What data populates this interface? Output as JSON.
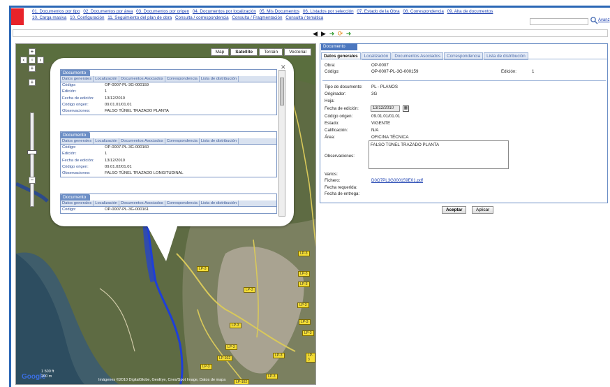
{
  "nav": {
    "links": [
      "01. Documentos por tipo",
      "02. Documentos por área",
      "03. Documentos por origen",
      "04. Documentos por localización",
      "05. Mis Documentos",
      "06. Listados por selección",
      "07. Estado de la Obra",
      "08. Correspondencia",
      "09. Alta de documentos",
      "10. Carga masiva",
      "10. Configuración",
      "11. Seguimiento del plan de obra",
      "Consulta / correspondencia",
      "Consulta / Fragmentación",
      "Consulta / temática"
    ]
  },
  "search": {
    "value": "",
    "link_label": "Avanz"
  },
  "map": {
    "types": [
      "Map",
      "Satellite",
      "Terrain",
      "Vectorial"
    ],
    "active_type": "Satellite",
    "road_labels": [
      "LP-3",
      "LP-3",
      "LP-3",
      "LP-3",
      "LP-3",
      "LP-3",
      "LP-3",
      "LP-3",
      "LP-3",
      "LP-3",
      "LP-3",
      "LP-3",
      "LP-3",
      "LP-3",
      "LP-102",
      "LP-102"
    ],
    "scale_ft": "1 500 ft",
    "scale_m": "200 m",
    "copyright": "Imágenes ©2010 DigitalGlobe, GeoEye, Cnes/Spot Image, Datos de mapa",
    "google": "Google"
  },
  "balloon": {
    "cards": [
      {
        "title": "Documento",
        "tabs": [
          "Datos generales",
          "Localización",
          "Documentos Asociados",
          "Correspondencia",
          "Lista de distribución"
        ],
        "rows": [
          {
            "label": "Código:",
            "value": "OP-0007-PL-3G-000159"
          },
          {
            "label": "Edición:",
            "value": "1"
          },
          {
            "label": "Fecha de edición:",
            "value": "13/12/2010"
          },
          {
            "label": "Código origen:",
            "value": "09.01.01/01.01"
          },
          {
            "label": "Observaciones:",
            "value": "FALSO TÚNEL TRAZADO PLANTA"
          }
        ]
      },
      {
        "title": "Documento",
        "tabs": [
          "Datos generales",
          "Localización",
          "Documentos Asociados",
          "Correspondencia",
          "Lista de distribución"
        ],
        "rows": [
          {
            "label": "Código:",
            "value": "OP-0007-PL-3G-000160"
          },
          {
            "label": "Edición:",
            "value": "1"
          },
          {
            "label": "Fecha de edición:",
            "value": "13/12/2010"
          },
          {
            "label": "Código origen:",
            "value": "09.01.02/01.01"
          },
          {
            "label": "Observaciones:",
            "value": "FALSO TÚNEL TRAZADO LONGITUDINAL"
          }
        ]
      },
      {
        "title": "Documento",
        "tabs": [
          "Datos generales",
          "Localización",
          "Documentos Asociados",
          "Correspondencia",
          "Lista de distribución"
        ],
        "rows": [
          {
            "label": "Código:",
            "value": "OP-0007-PL-3G-000161"
          }
        ]
      }
    ]
  },
  "panel": {
    "title": "Documento",
    "tabs": [
      "Datos generales",
      "Localización",
      "Documentos Asociados",
      "Correspondencia",
      "Lista de distribución"
    ],
    "obra_label": "Obra:",
    "obra": "OP-0007",
    "codigo_label": "Código:",
    "codigo": "OP-0007-PL-3G-000159",
    "edicion_label": "Edición:",
    "edicion": "1",
    "tipo_label": "Tipo de documento:",
    "tipo": "PL - PLANOS",
    "originador_label": "Originador:",
    "originador": "3G",
    "hoja_label": "Hoja:",
    "hoja": "",
    "fecha_label": "Fecha de edición:",
    "fecha": "13/12/2010",
    "codorigen_label": "Código origen:",
    "codorigen": "09.01.01/01.01",
    "estado_label": "Estado:",
    "estado": "VIGENTE",
    "calificacion_label": "Calificación:",
    "calificacion": "N/A",
    "area_label": "Área:",
    "area": "OFICINA TÉCNICA",
    "observaciones_label": "Observaciones:",
    "observaciones": "FALSO TÚNEL TRAZADO PLANTA",
    "varios_label": "Varios:",
    "fichero_label": "Fichero:",
    "fichero": "D0O7PL3G000159E01.pdf",
    "fecha_req_label": "Fecha requerida:",
    "fecha_ent_label": "Fecha de entrega:"
  },
  "buttons": {
    "accept": "Aceptar",
    "apply": "Aplicar"
  },
  "colors": {
    "accent": "#2b67b5",
    "logo": "#e8232a",
    "tab_header": "#6d8fc6"
  }
}
